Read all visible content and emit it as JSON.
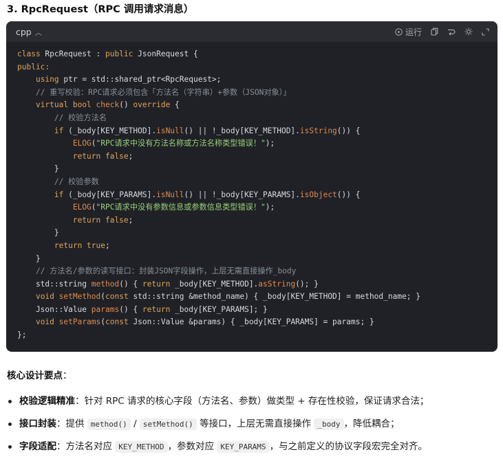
{
  "heading": "3. RpcRequest（RPC 调用请求消息）",
  "code_block": {
    "language": "cpp",
    "toolbar": {
      "run_label": "运行"
    },
    "lines": [
      [
        [
          "kw",
          "class "
        ],
        [
          "tx",
          "RpcRequest : "
        ],
        [
          "kw",
          "public "
        ],
        [
          "tx",
          "JsonRequest {"
        ]
      ],
      [
        [
          "kw",
          "public:"
        ]
      ],
      [
        [
          "tx",
          "    "
        ],
        [
          "kw",
          "using "
        ],
        [
          "tx",
          "ptr = std::shared_ptr<RpcRequest>;"
        ]
      ],
      [
        [
          "tx",
          "    "
        ],
        [
          "cm",
          "// 重写校验：RPC请求必须包含「方法名（字符串）+参数（JSON对象）」"
        ]
      ],
      [
        [
          "tx",
          "    "
        ],
        [
          "kw",
          "virtual bool "
        ],
        [
          "fn",
          "check"
        ],
        [
          "tx",
          "() "
        ],
        [
          "kw",
          "override "
        ],
        [
          "tx",
          "{"
        ]
      ],
      [
        [
          "tx",
          "        "
        ],
        [
          "cm",
          "// 校验方法名"
        ]
      ],
      [
        [
          "tx",
          "        "
        ],
        [
          "kw",
          "if "
        ],
        [
          "tx",
          "(_body[KEY_METHOD]."
        ],
        [
          "fn",
          "isNull"
        ],
        [
          "tx",
          "() || !_body[KEY_METHOD]."
        ],
        [
          "fn",
          "isString"
        ],
        [
          "tx",
          "()) {"
        ]
      ],
      [
        [
          "tx",
          "            "
        ],
        [
          "fn",
          "ELOG"
        ],
        [
          "tx",
          "("
        ],
        [
          "str",
          "\"RPC请求中没有方法名称或方法名称类型错误！\""
        ],
        [
          "tx",
          ");"
        ]
      ],
      [
        [
          "tx",
          "            "
        ],
        [
          "kw",
          "return false"
        ],
        [
          "tx",
          ";"
        ]
      ],
      [
        [
          "tx",
          "        }"
        ]
      ],
      [
        [
          "tx",
          "        "
        ],
        [
          "cm",
          "// 校验参数"
        ]
      ],
      [
        [
          "tx",
          "        "
        ],
        [
          "kw",
          "if "
        ],
        [
          "tx",
          "(_body[KEY_PARAMS]."
        ],
        [
          "fn",
          "isNull"
        ],
        [
          "tx",
          "() || !_body[KEY_PARAMS]."
        ],
        [
          "fn",
          "isObject"
        ],
        [
          "tx",
          "()) {"
        ]
      ],
      [
        [
          "tx",
          "            "
        ],
        [
          "fn",
          "ELOG"
        ],
        [
          "tx",
          "("
        ],
        [
          "str",
          "\"RPC请求中没有参数信息或参数信息类型错误！\""
        ],
        [
          "tx",
          ");"
        ]
      ],
      [
        [
          "tx",
          "            "
        ],
        [
          "kw",
          "return false"
        ],
        [
          "tx",
          ";"
        ]
      ],
      [
        [
          "tx",
          "        }"
        ]
      ],
      [
        [
          "tx",
          "        "
        ],
        [
          "kw",
          "return true"
        ],
        [
          "tx",
          ";"
        ]
      ],
      [
        [
          "tx",
          "    }"
        ]
      ],
      [
        [
          "tx",
          "    "
        ],
        [
          "cm",
          "// 方法名/参数的读写接口：封装JSON字段操作，上层无需直接操作_body"
        ]
      ],
      [
        [
          "tx",
          "    std::string "
        ],
        [
          "fn",
          "method"
        ],
        [
          "tx",
          "() { "
        ],
        [
          "kw",
          "return "
        ],
        [
          "tx",
          "_body[KEY_METHOD]."
        ],
        [
          "fn",
          "asString"
        ],
        [
          "tx",
          "(); }"
        ]
      ],
      [
        [
          "tx",
          "    "
        ],
        [
          "kw",
          "void "
        ],
        [
          "fn",
          "setMethod"
        ],
        [
          "tx",
          "("
        ],
        [
          "kw",
          "const "
        ],
        [
          "tx",
          "std::string &method_name) { _body[KEY_METHOD] = method_name; }"
        ]
      ],
      [
        [
          "tx",
          "    Json::Value "
        ],
        [
          "fn",
          "params"
        ],
        [
          "tx",
          "() { "
        ],
        [
          "kw",
          "return "
        ],
        [
          "tx",
          "_body[KEY_PARAMS]; }"
        ]
      ],
      [
        [
          "tx",
          "    "
        ],
        [
          "kw",
          "void "
        ],
        [
          "fn",
          "setParams"
        ],
        [
          "tx",
          "("
        ],
        [
          "kw",
          "const "
        ],
        [
          "tx",
          "Json::Value &params) { _body[KEY_PARAMS] = params; }"
        ]
      ],
      [
        [
          "tx",
          "};"
        ]
      ]
    ]
  },
  "section_title": "核心设计要点",
  "section_colon": "：",
  "bullets": [
    {
      "bold": "校验逻辑精准",
      "parts": [
        [
          "t",
          "：针对 RPC 请求的核心字段（方法名、参数）做类型 + 存在性校验，保证请求合法；"
        ]
      ]
    },
    {
      "bold": "接口封装",
      "parts": [
        [
          "t",
          "：提供 "
        ],
        [
          "c",
          "method()"
        ],
        [
          "t",
          " / "
        ],
        [
          "c",
          "setMethod()"
        ],
        [
          "t",
          " 等接口，上层无需直接操作 "
        ],
        [
          "c",
          "_body"
        ],
        [
          "t",
          "，降低耦合；"
        ]
      ]
    },
    {
      "bold": "字段适配",
      "parts": [
        [
          "t",
          "：方法名对应 "
        ],
        [
          "c",
          "KEY_METHOD"
        ],
        [
          "t",
          "，参数对应 "
        ],
        [
          "c",
          "KEY_PARAMS"
        ],
        [
          "t",
          "，与之前定义的协议字段宏完全对齐。"
        ]
      ]
    }
  ]
}
